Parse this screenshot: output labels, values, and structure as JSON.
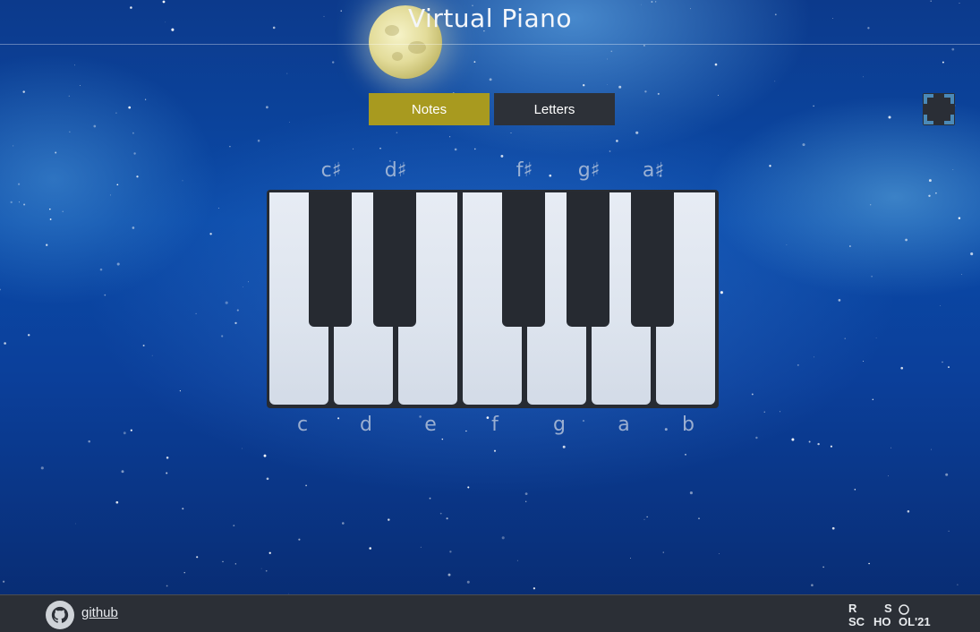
{
  "header": {
    "title": "Virtual Piano"
  },
  "toggle": {
    "notes_label": "Notes",
    "letters_label": "Letters",
    "active": "Notes"
  },
  "fullscreen": {
    "icon": "fullscreen-icon"
  },
  "piano": {
    "sharp_labels": [
      "c♯",
      "d♯",
      "f♯",
      "g♯",
      "a♯"
    ],
    "white_labels": [
      "c",
      "d",
      "e",
      "f",
      "g",
      "a",
      "b"
    ]
  },
  "footer": {
    "github_label": "github",
    "github_icon": "github-icon",
    "logo_text": "RS SCHOOL'21"
  },
  "colors": {
    "active_button": "#a89a1f",
    "inactive_button": "#2d3138",
    "footer_bg": "#2b2f36",
    "key_black": "#262a31",
    "key_white": "#e3e9f1"
  }
}
